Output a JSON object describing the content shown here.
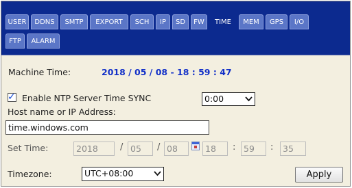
{
  "tabs": [
    {
      "label": "USER",
      "active": false
    },
    {
      "label": "DDNS",
      "active": false
    },
    {
      "label": "SMTP",
      "active": false
    },
    {
      "label": "EXPORT",
      "active": false
    },
    {
      "label": "SCH",
      "active": false
    },
    {
      "label": "IP",
      "active": false
    },
    {
      "label": "SD",
      "active": false
    },
    {
      "label": "FW",
      "active": false
    },
    {
      "label": "TIME",
      "active": true
    },
    {
      "label": "MEM",
      "active": false
    },
    {
      "label": "GPS",
      "active": false
    },
    {
      "label": "I/O",
      "active": false
    },
    {
      "label": "FTP",
      "active": false
    },
    {
      "label": "ALARM",
      "active": false
    }
  ],
  "machine_time": {
    "label": "Machine Time:",
    "value": "2018 / 05 / 08 - 18 : 59 : 47"
  },
  "ntp": {
    "checkbox_label": "Enable NTP Server Time SYNC",
    "checked": true,
    "sync_value": "0:00",
    "host_label": "Host name or IP Address:",
    "host_value": "time.windows.com"
  },
  "set_time": {
    "label": "Set Time:",
    "year": "2018",
    "month": "05",
    "day": "08",
    "hour": "18",
    "minute": "59",
    "second": "35",
    "date_sep": "/",
    "time_sep": ":"
  },
  "timezone": {
    "label": "Timezone:",
    "value": "UTC+08:00"
  },
  "apply_label": "Apply",
  "colors": {
    "tabbar_bg": "#0c2a8f",
    "tab_bg": "#5b76c7",
    "content_bg": "#f3efe0",
    "machine_time_value": "#1230c8"
  }
}
